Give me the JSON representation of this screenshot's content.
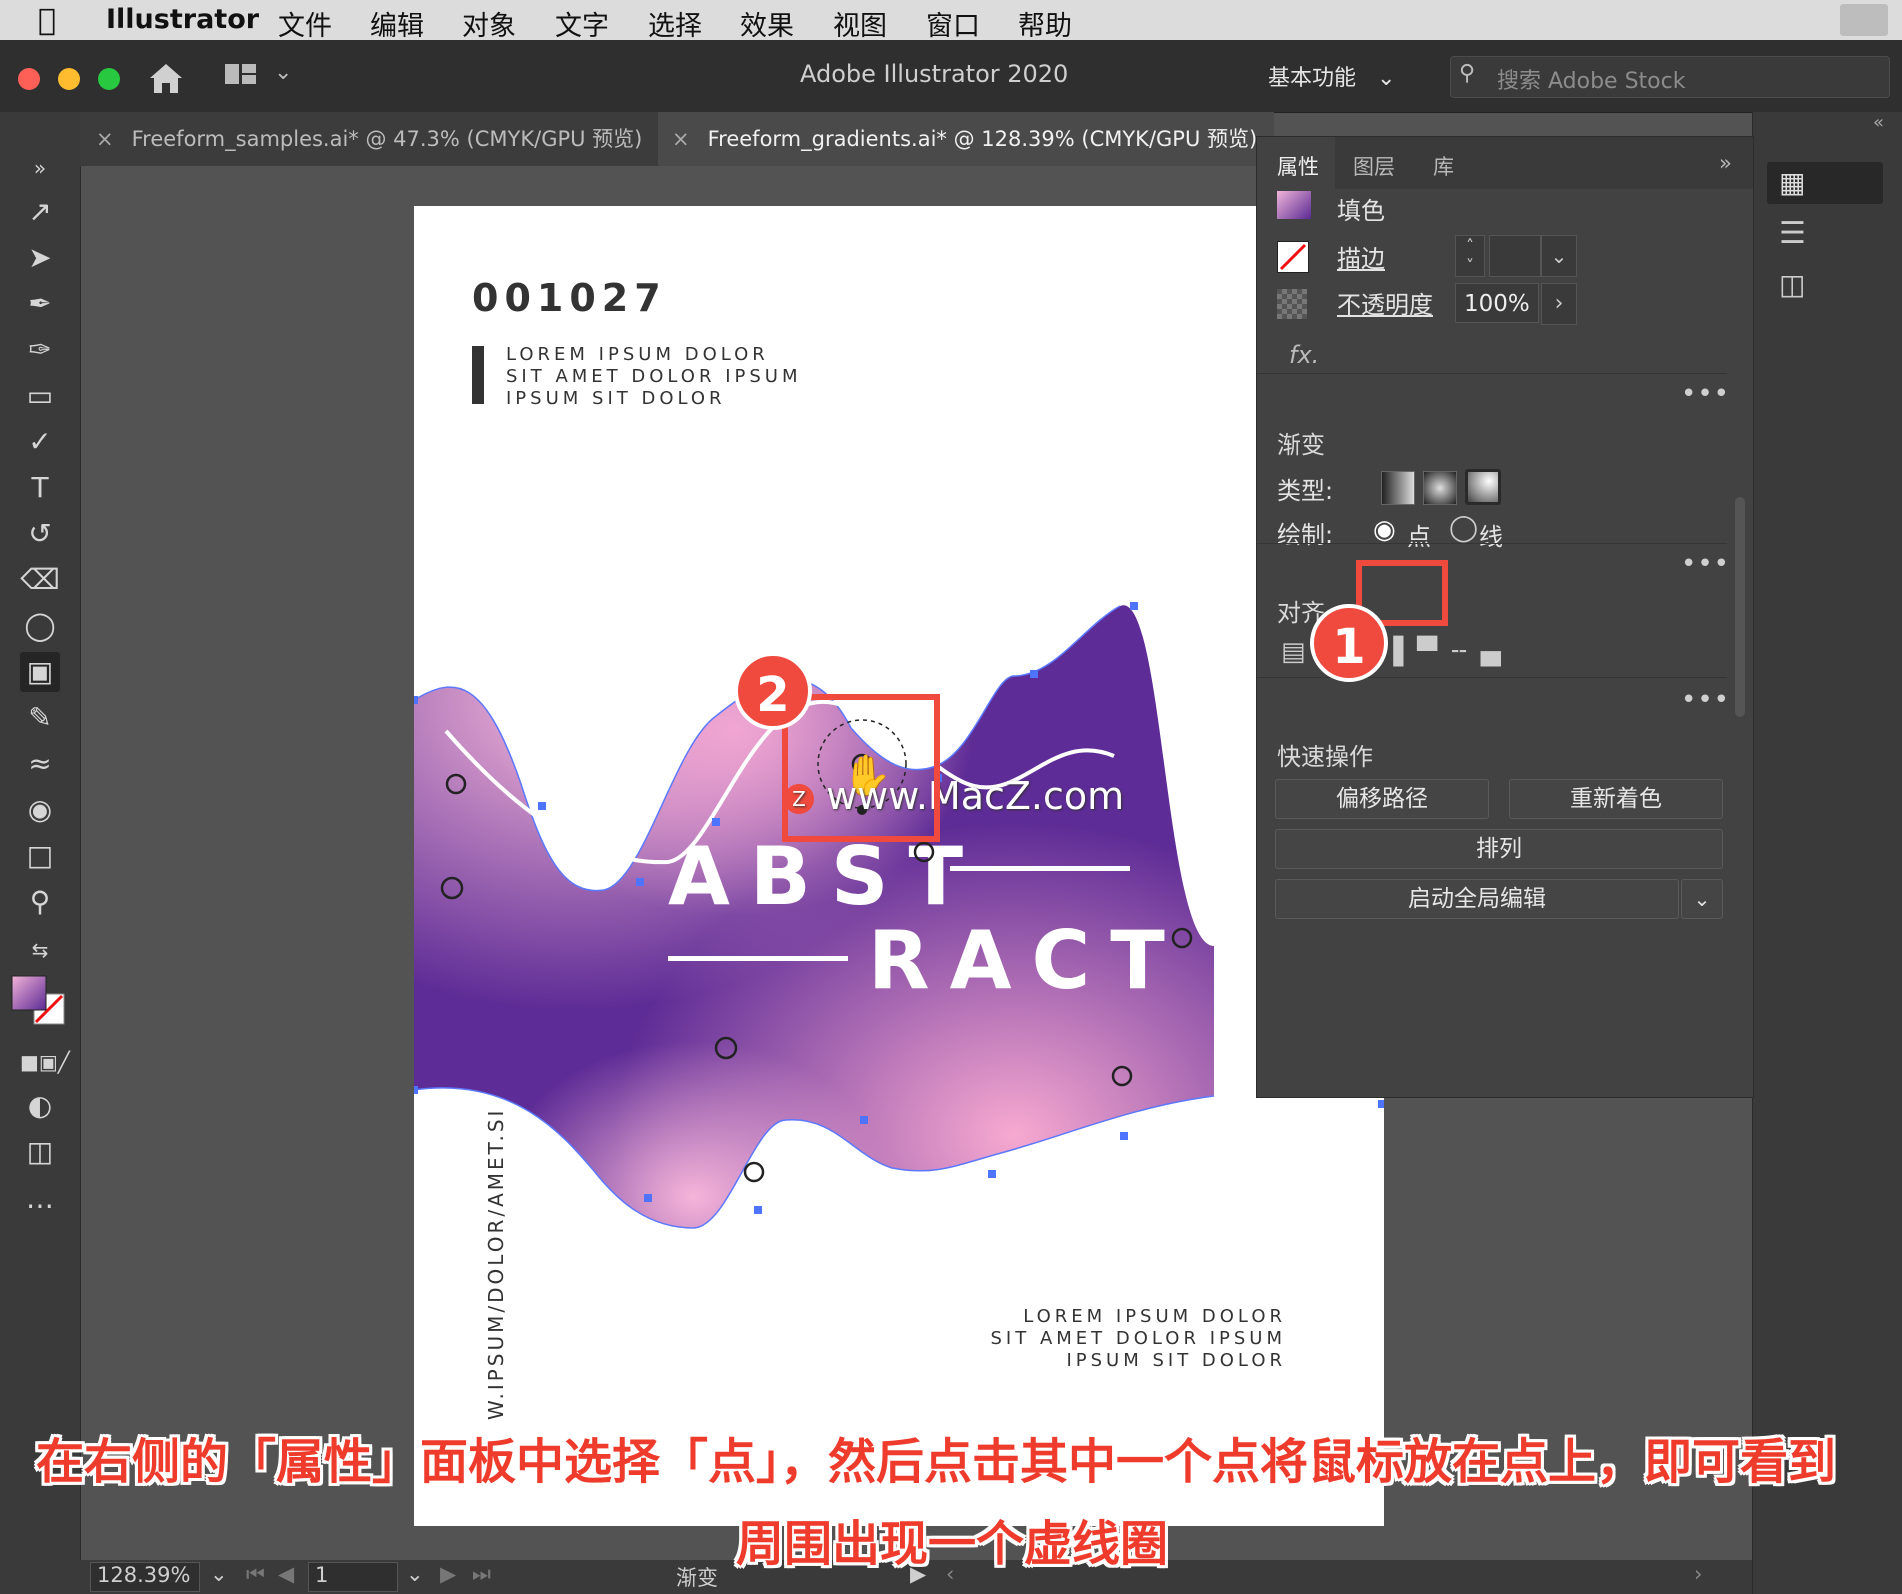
{
  "menubar": {
    "app_name": "Illustrator",
    "items": [
      "文件",
      "编辑",
      "对象",
      "文字",
      "选择",
      "效果",
      "视图",
      "窗口",
      "帮助"
    ]
  },
  "titlebar": {
    "title": "Adobe Illustrator 2020",
    "workspace": "基本功能",
    "search_placeholder": "搜索 Adobe Stock"
  },
  "tabs": [
    {
      "label": "Freeform_samples.ai* @ 47.3% (CMYK/GPU 预览)",
      "close": "×"
    },
    {
      "label": "Freeform_gradients.ai* @ 128.39% (CMYK/GPU 预览)",
      "close": "×"
    }
  ],
  "artboard": {
    "number": "001027",
    "top_text": [
      "LOREM IPSUM DOLOR",
      "SIT AMET DOLOR IPSUM",
      "IPSUM SIT DOLOR"
    ],
    "headline_1": "ABST",
    "headline_2": "RACT",
    "vertical_text": "W.IPSUM/DOLOR/AMET.SI",
    "bottom_text": [
      "LOREM IPSUM DOLOR",
      "SIT AMET DOLOR IPSUM",
      "IPSUM SIT DOLOR"
    ],
    "watermark": "www.MacZ.com"
  },
  "panel": {
    "tabs": [
      "属性",
      "图层",
      "库"
    ],
    "fill_label": "填色",
    "stroke_label": "描边",
    "opacity_label": "不透明度",
    "opacity_value": "100%",
    "fx_label": "fx.",
    "gradient_title": "渐变",
    "type_label": "类型:",
    "draw_label": "绘制:",
    "draw_points": "点",
    "draw_lines": "线",
    "align_title": "对齐",
    "quick_title": "快速操作",
    "btn_offset": "偏移路径",
    "btn_recolor": "重新着色",
    "btn_arrange": "排列",
    "btn_global": "启动全局编辑",
    "more": "•••"
  },
  "statusbar": {
    "zoom": "128.39%",
    "page": "1",
    "tool": "渐变"
  },
  "annotations": {
    "badge_1": "1",
    "badge_2": "2",
    "caption_line1": "在右侧的「属性」面板中选择「点」，然后点击其中一个点将鼠标放在点上，即可看到",
    "caption_line2": "周围出现一个虚线圈"
  },
  "colors": {
    "accent_red": "#ef4a3d",
    "gradient_purple": "#6a2aa0",
    "gradient_pink": "#f0a6cf"
  }
}
